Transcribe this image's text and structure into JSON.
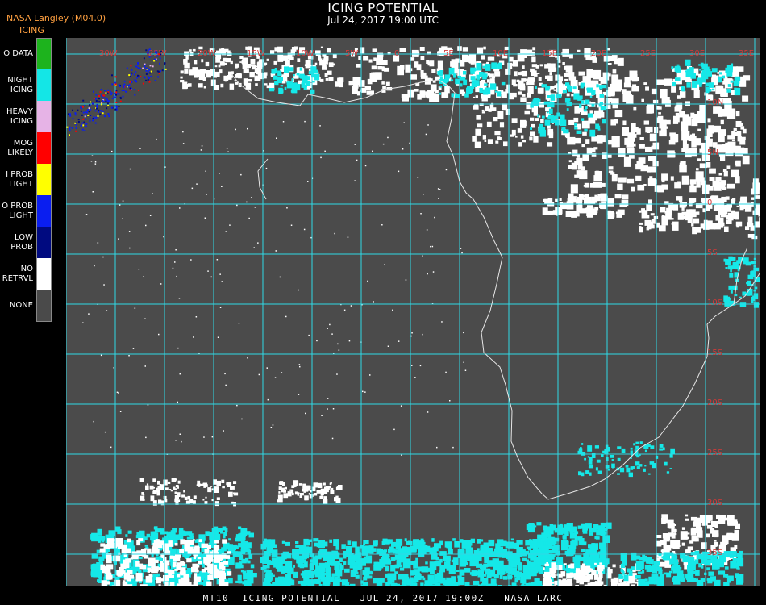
{
  "header": {
    "title": "ICING POTENTIAL",
    "date": "Jul 24, 2017 19:00 UTC",
    "producer": "NASA Langley (M04.0)",
    "product": "ICING"
  },
  "legend": {
    "items": [
      {
        "label": "NO DATA",
        "display": "O DATA",
        "color": "#1db31d"
      },
      {
        "label": "NIGHT ICING",
        "display": "NIGHT\nICING",
        "color": "#14e6e6"
      },
      {
        "label": "HEAVY ICING",
        "display": "HEAVY\nICING",
        "color": "#e6b3e6"
      },
      {
        "label": "MOG LIKELY",
        "display": "MOG\nLIKELY",
        "color": "#ff0000"
      },
      {
        "label": "HI PROB LIGHT",
        "display": "I PROB\nLIGHT",
        "color": "#ffff00"
      },
      {
        "label": "LO PROB LIGHT",
        "display": "O PROB\nLIGHT",
        "color": "#0a1ef0"
      },
      {
        "label": "LOW PROB",
        "display": "LOW\nPROB",
        "color": "#000a80"
      },
      {
        "label": "NO RETRVL",
        "display": "NO\nRETRVL",
        "color": "#ffffff"
      },
      {
        "label": "NONE",
        "display": "NONE",
        "color": "#4a4a4a"
      }
    ]
  },
  "map": {
    "background_color": "#4b4b4b",
    "grid_color": "#2fd9e6",
    "coastline_color": "#e6e6e6",
    "label_color": "#d03a3a",
    "cloud_color_white": "#ffffff",
    "cloud_color_cyan": "#15e8e8",
    "longitude_labels": [
      "30W",
      "25W",
      "20W",
      "15W",
      "10W",
      "5W",
      "0",
      "5E",
      "10E",
      "15E",
      "20E",
      "25E",
      "30E",
      "35E"
    ],
    "latitude_labels": [
      "10N",
      "5N",
      "0",
      "5S",
      "10S",
      "15S",
      "20S",
      "25S",
      "30S",
      "35S",
      "40S"
    ]
  },
  "footer": {
    "text": "MT10  ICING POTENTIAL   JUL 24, 2017 19:00Z   NASA LARC"
  }
}
